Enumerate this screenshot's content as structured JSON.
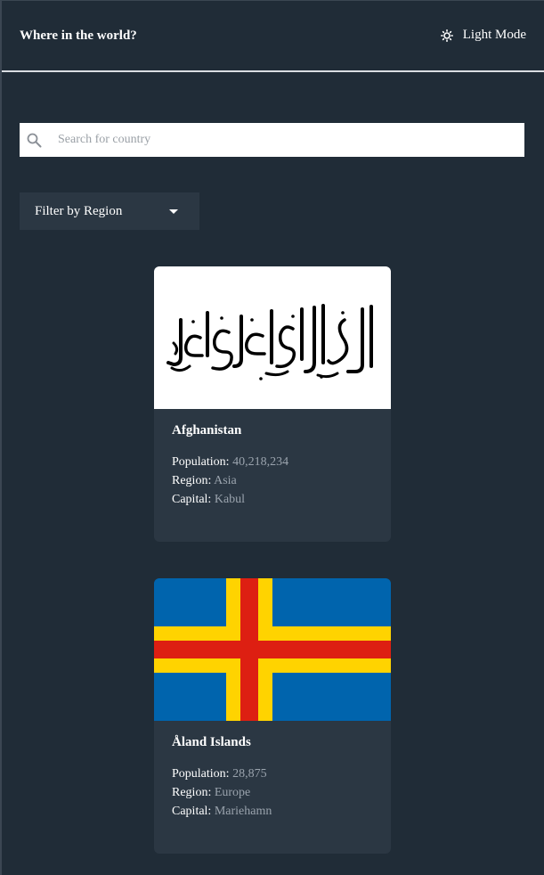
{
  "header": {
    "title": "Where in the world?",
    "mode_label": "Light Mode",
    "mode_icon": "sun-icon"
  },
  "search": {
    "placeholder": "Search for country",
    "value": "",
    "icon": "search-icon"
  },
  "filter": {
    "label": "Filter by Region",
    "icon": "caret-down-icon"
  },
  "countries": [
    {
      "name": "Afghanistan",
      "population_label": "Population:",
      "population": "40,218,234",
      "region_label": "Region:",
      "region": "Asia",
      "capital_label": "Capital:",
      "capital": "Kabul",
      "flag": "afghanistan-flag"
    },
    {
      "name": "Åland Islands",
      "population_label": "Population:",
      "population": "28,875",
      "region_label": "Region:",
      "region": "Europe",
      "capital_label": "Capital:",
      "capital": "Mariehamn",
      "flag": "aland-islands-flag"
    }
  ],
  "colors": {
    "background": "#202c37",
    "element": "#2b3743",
    "text": "#ffffff",
    "muted": "#9aa3ad"
  }
}
